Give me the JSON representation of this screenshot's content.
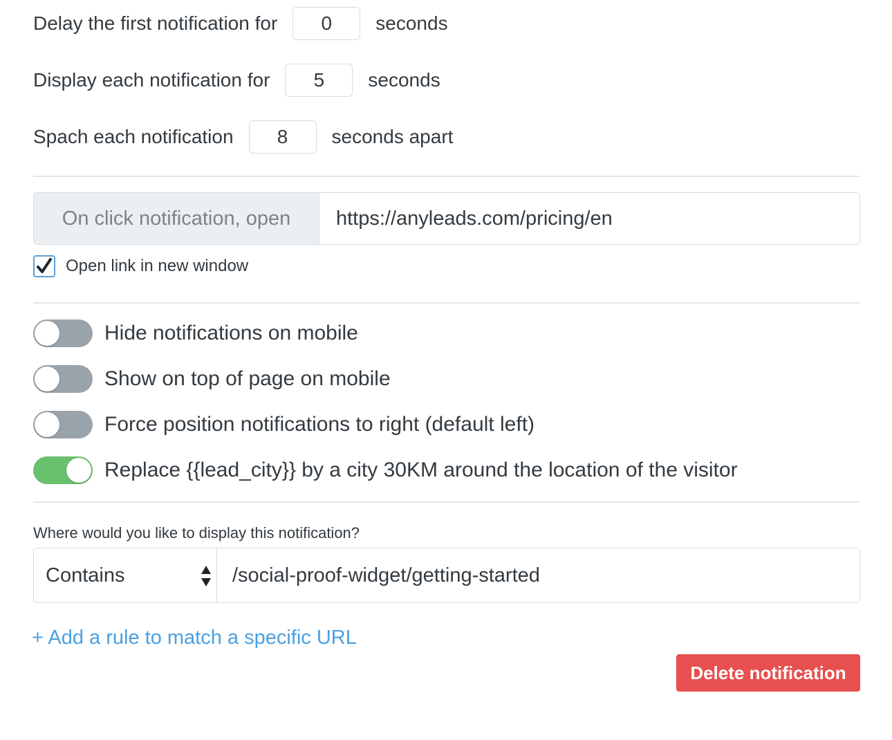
{
  "timing": {
    "delay": {
      "label": "Delay the first notification for",
      "value": "0",
      "unit": "seconds"
    },
    "display": {
      "label": "Display each notification for",
      "value": "5",
      "unit": "seconds"
    },
    "space": {
      "label": "Spach each notification",
      "value": "8",
      "unit": "seconds apart"
    }
  },
  "click_url": {
    "addon_label": "On click notification, open",
    "value": "https://anyleads.com/pricing/en"
  },
  "new_window": {
    "label": "Open link in new window",
    "checked": true
  },
  "toggles": [
    {
      "label": "Hide notifications on mobile",
      "on": false
    },
    {
      "label": "Show on top of page on mobile",
      "on": false
    },
    {
      "label": "Force position notifications to right (default left)",
      "on": false
    },
    {
      "label": "Replace {{lead_city}} by a city 30KM around the location of the visitor",
      "on": true
    }
  ],
  "display_rule": {
    "question": "Where would you like to display this notification?",
    "match_type": "Contains",
    "path": "/social-proof-widget/getting-started"
  },
  "add_rule_link": "+ Add a rule to match a specific URL",
  "delete_button": "Delete notification",
  "colors": {
    "toggle_on": "#69c06d",
    "toggle_off": "#9aa2aa",
    "link": "#4a9fe0",
    "danger": "#e84f4f",
    "checkbox_border": "#5a9fd8"
  }
}
